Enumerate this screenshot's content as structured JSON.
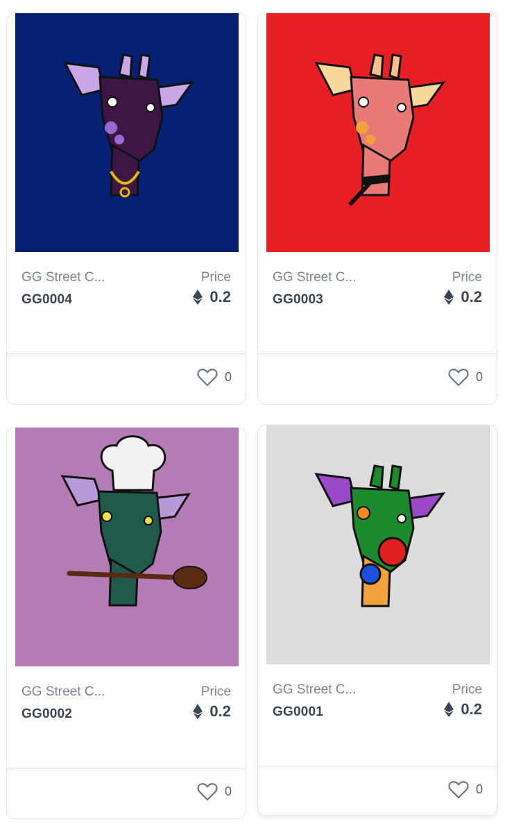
{
  "colors": {
    "card_border": "#e3e6ea",
    "muted_text": "#7b8591",
    "strong_text": "#3a4651"
  },
  "cards": [
    {
      "collection": "GG Street C...",
      "token_id": "GG0004",
      "price_label": "Price",
      "currency_icon": "ethereum-icon",
      "price": "0.2",
      "like_icon": "heart-outline-icon",
      "likes": "0",
      "art_background": "#062073",
      "art_subject": "purple giraffe with gold chain"
    },
    {
      "collection": "GG Street C...",
      "token_id": "GG0003",
      "price_label": "Price",
      "currency_icon": "ethereum-icon",
      "price": "0.2",
      "like_icon": "heart-outline-icon",
      "likes": "0",
      "art_background": "#e81e25",
      "art_subject": "pink giraffe with black collar"
    },
    {
      "collection": "GG Street C...",
      "token_id": "GG0002",
      "price_label": "Price",
      "currency_icon": "ethereum-icon",
      "price": "0.2",
      "like_icon": "heart-outline-icon",
      "likes": "0",
      "art_background": "#b57bb5",
      "art_subject": "green giraffe with chef hat and wooden spoon"
    },
    {
      "collection": "GG Street C...",
      "token_id": "GG0001",
      "price_label": "Price",
      "currency_icon": "ethereum-icon",
      "price": "0.2",
      "like_icon": "heart-outline-icon",
      "likes": "0",
      "art_background": "#dcdcdc",
      "art_subject": "multicolor giraffe"
    }
  ]
}
